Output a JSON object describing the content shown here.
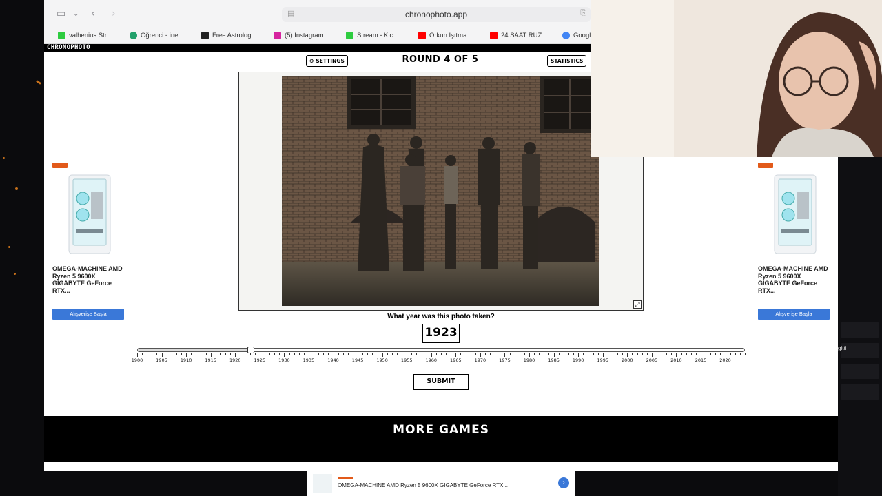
{
  "browser": {
    "url": "chronophoto.app",
    "bookmarks": [
      {
        "label": "valhenius Str...",
        "color": "#2ecc40"
      },
      {
        "label": "Öğrenci - ine...",
        "color": "#22a06b"
      },
      {
        "label": "Free Astrolog...",
        "color": "#222222"
      },
      {
        "label": "(5) Instagram...",
        "color": "#d6249f"
      },
      {
        "label": "Stream - Kic...",
        "color": "#53fc18"
      },
      {
        "label": "Orkun Işıtma...",
        "color": "#ff0000"
      },
      {
        "label": "24 SAAT RÜZ...",
        "color": "#ff0000"
      },
      {
        "label": "Googl",
        "color": "#4285f4"
      }
    ]
  },
  "site": {
    "brand": "CHRONOPHOTO",
    "settings_label": "⚙ SETTINGS",
    "round_label": "ROUND 4 OF 5",
    "statistics_label": "STATISTICS",
    "question": "What year was this photo taken?",
    "selected_year": "1923",
    "submit_label": "SUBMIT",
    "more_games": "MORE GAMES"
  },
  "timeline": {
    "min": 1900,
    "max": 2024,
    "value": 1923,
    "labels": [
      "1900",
      "1905",
      "1910",
      "1915",
      "1920",
      "1925",
      "1930",
      "1935",
      "1940",
      "1945",
      "1950",
      "1955",
      "1960",
      "1965",
      "1970",
      "1975",
      "1980",
      "1985",
      "1990",
      "1995",
      "2000",
      "2005",
      "2010",
      "2015",
      "2020"
    ]
  },
  "ads": {
    "left": {
      "title": "OMEGA-MACHINE AMD Ryzen 5 9600X GIGABYTE GeForce RTX...",
      "button": "Alışverişe Başla"
    },
    "right": {
      "title": "OMEGA-MACHINE AMD Ryzen 5 9600X GIGABYTE GeForce RTX...",
      "button": "Alışverişe Başla"
    },
    "bottom": {
      "title": "OMEGA-MACHINE AMD Ryzen 5 9600X GIGABYTE GeForce RTX...",
      "go": "›"
    }
  },
  "side_panel": {
    "text": "gitti"
  },
  "colors": {
    "accent": "#3a78d8",
    "sparkle": "#e8821e",
    "brand_bar": "#000000"
  }
}
